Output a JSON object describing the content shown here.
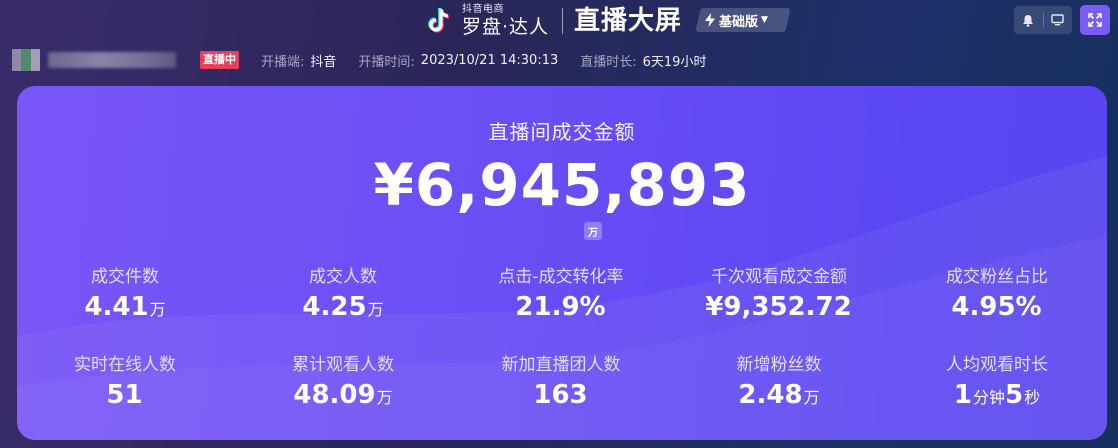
{
  "header": {
    "brand_sub": "抖音电商",
    "brand_main": "罗盘·达人",
    "screen_title": "直播大屏",
    "version_label": "基础版"
  },
  "info_bar": {
    "live_badge": "直播中",
    "platform_label": "开播端:",
    "platform_value": "抖音",
    "start_label": "开播时间:",
    "start_value": "2023/10/21 14:30:13",
    "duration_label": "直播时长:",
    "duration_value": "6天19小时"
  },
  "gmv": {
    "title": "直播间成交金额",
    "value": "¥6,945,893",
    "unit_chip": "万"
  },
  "metrics": [
    {
      "label": "成交件数",
      "value": "4.41",
      "unit": "万"
    },
    {
      "label": "成交人数",
      "value": "4.25",
      "unit": "万"
    },
    {
      "label": "点击-成交转化率",
      "value": "21.9%",
      "unit": ""
    },
    {
      "label": "千次观看成交金额",
      "value": "¥9,352.72",
      "unit": ""
    },
    {
      "label": "成交粉丝占比",
      "value": "4.95%",
      "unit": ""
    },
    {
      "label": "实时在线人数",
      "value": "51",
      "unit": ""
    },
    {
      "label": "累计观看人数",
      "value": "48.09",
      "unit": "万"
    },
    {
      "label": "新加直播团人数",
      "value": "163",
      "unit": ""
    },
    {
      "label": "新增粉丝数",
      "value": "2.48",
      "unit": "万"
    },
    {
      "label": "人均观看时长",
      "value": "",
      "unit": ""
    }
  ],
  "avg_watch": {
    "min_value": "1",
    "min_unit": "分钟",
    "sec_value": "5",
    "sec_unit": "秒"
  },
  "colors": {
    "accent": "#7a5cf2",
    "live_badge": "#e8405a",
    "card_start": "#7956f7",
    "card_end": "#5a46f0"
  },
  "icons": {
    "logo": "tiktok-logo-icon",
    "version": "bolt-icon",
    "notification": "bell-icon",
    "display": "monitor-icon",
    "fullscreen": "fullscreen-icon"
  }
}
